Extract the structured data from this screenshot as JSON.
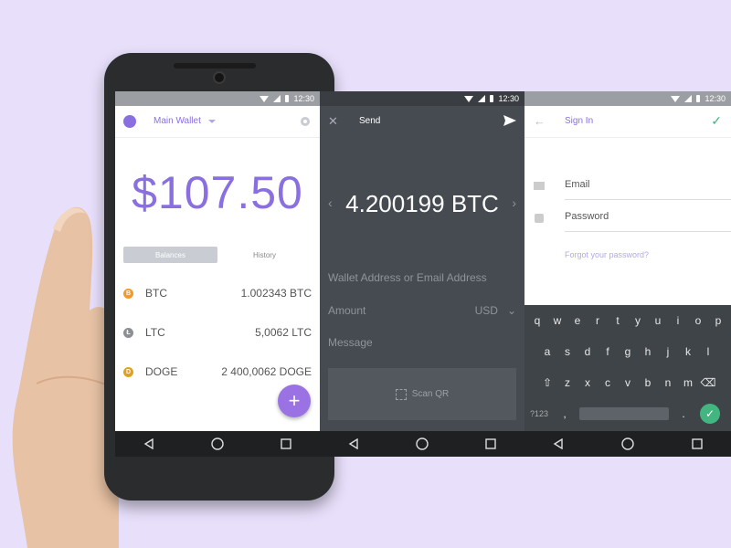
{
  "status": {
    "time": "12:30"
  },
  "wallet": {
    "title": "Main Wallet",
    "balance": "$107.50",
    "tabs": [
      "Balances",
      "History"
    ],
    "coins": [
      {
        "symbol": "BTC",
        "amount": "1.002343 BTC",
        "color": "#f39a2b",
        "badge": "B"
      },
      {
        "symbol": "LTC",
        "amount": "5,0062 LTC",
        "color": "#8c8f94",
        "badge": "Ł"
      },
      {
        "symbol": "DOGE",
        "amount": "2 400,0062 DOGE",
        "color": "#e0a21e",
        "badge": "D"
      }
    ],
    "fab": "+"
  },
  "send": {
    "title": "Send",
    "amount": "4.200199 BTC",
    "address_placeholder": "Wallet Address or Email Address",
    "amount_label": "Amount",
    "currency": "USD",
    "message_label": "Message",
    "scan_label": "Scan QR"
  },
  "signin": {
    "title": "Sign In",
    "email_placeholder": "Email",
    "password_placeholder": "Password",
    "forgot": "Forgot your password?",
    "keyboard": {
      "row1": [
        "q",
        "w",
        "e",
        "r",
        "t",
        "y",
        "u",
        "i",
        "o",
        "p"
      ],
      "row2": [
        "a",
        "s",
        "d",
        "f",
        "g",
        "h",
        "j",
        "k",
        "l"
      ],
      "row3": [
        "z",
        "x",
        "c",
        "v",
        "b",
        "n",
        "m"
      ],
      "symbols": "?123",
      "comma": ",",
      "period": "."
    }
  },
  "colors": {
    "accent": "#8a6fe0",
    "background": "#e8e0fb",
    "confirm": "#43b581"
  }
}
